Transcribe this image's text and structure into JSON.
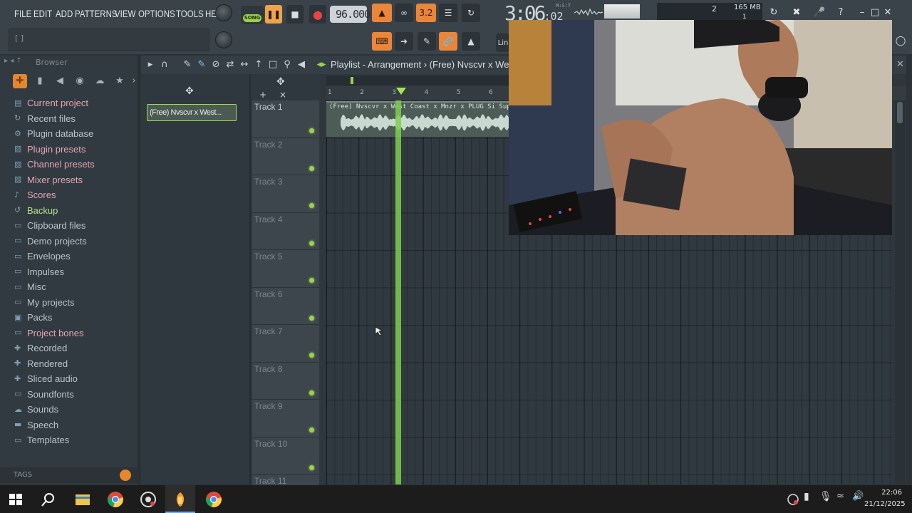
{
  "menu": [
    "FILE",
    "EDIT",
    "ADD",
    "PATTERNS",
    "VIEW",
    "OPTIONS",
    "TOOLS",
    "HELP"
  ],
  "transport": {
    "mode_label": "SONG",
    "tempo": "96.000",
    "snap_label": "3.2",
    "line_label": "Lin"
  },
  "time_display": {
    "main": "3:06",
    "fraction": ":02",
    "unit": "M:S:T"
  },
  "cpu": {
    "value": "2",
    "memory": "165 MB",
    "memory_sub": "1"
  },
  "hint_bar": {
    "text": "[ ]"
  },
  "browser": {
    "title": "Browser",
    "items": [
      {
        "label": "Current project",
        "icon": "project-icon",
        "tone": "pink"
      },
      {
        "label": "Recent files",
        "icon": "recent-icon",
        "tone": "normal"
      },
      {
        "label": "Plugin database",
        "icon": "plugin-icon",
        "tone": "normal"
      },
      {
        "label": "Plugin presets",
        "icon": "preset-icon",
        "tone": "pink"
      },
      {
        "label": "Channel presets",
        "icon": "preset-icon",
        "tone": "pink"
      },
      {
        "label": "Mixer presets",
        "icon": "preset-icon",
        "tone": "pink"
      },
      {
        "label": "Scores",
        "icon": "note-icon",
        "tone": "pink"
      },
      {
        "label": "Backup",
        "icon": "backup-icon",
        "tone": "green"
      },
      {
        "label": "Clipboard files",
        "icon": "folder-icon",
        "tone": "normal"
      },
      {
        "label": "Demo projects",
        "icon": "folder-icon",
        "tone": "normal"
      },
      {
        "label": "Envelopes",
        "icon": "folder-icon",
        "tone": "normal"
      },
      {
        "label": "Impulses",
        "icon": "folder-icon",
        "tone": "normal"
      },
      {
        "label": "Misc",
        "icon": "folder-icon",
        "tone": "normal"
      },
      {
        "label": "My projects",
        "icon": "folder-icon",
        "tone": "normal"
      },
      {
        "label": "Packs",
        "icon": "packs-icon",
        "tone": "normal"
      },
      {
        "label": "Project bones",
        "icon": "folder-icon",
        "tone": "pink"
      },
      {
        "label": "Recorded",
        "icon": "recorded-icon",
        "tone": "normal"
      },
      {
        "label": "Rendered",
        "icon": "rendered-icon",
        "tone": "normal"
      },
      {
        "label": "Sliced audio",
        "icon": "sliced-icon",
        "tone": "normal"
      },
      {
        "label": "Soundfonts",
        "icon": "folder-icon",
        "tone": "normal"
      },
      {
        "label": "Sounds",
        "icon": "cloud-icon",
        "tone": "normal"
      },
      {
        "label": "Speech",
        "icon": "speech-icon",
        "tone": "normal"
      },
      {
        "label": "Templates",
        "icon": "folder-icon",
        "tone": "normal"
      }
    ],
    "tags_label": "TAGS"
  },
  "playlist": {
    "title": "Playlist - Arrangement › (Free) Nvscvr x We",
    "picker_clip": "(Free) Nvscvr x West...",
    "clip_label": "(Free) Nvscvr x West Coast x Mnzr x PLUG Si Supien",
    "ruler": [
      "1",
      "2",
      "3",
      "4",
      "5",
      "6"
    ],
    "tracks": [
      "Track 1",
      "Track 2",
      "Track 3",
      "Track 4",
      "Track 5",
      "Track 6",
      "Track 7",
      "Track 8",
      "Track 9",
      "Track 10",
      "Track 11"
    ]
  },
  "taskbar": {
    "time": "22:06",
    "date": "21/12/2025"
  },
  "colors": {
    "accent": "#e9863a",
    "playhead": "#7fcf4a",
    "led": "#9bd24d"
  }
}
